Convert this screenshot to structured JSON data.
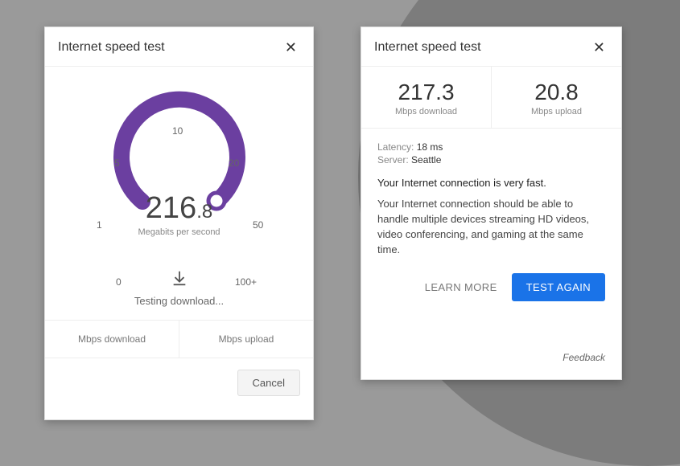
{
  "left": {
    "title": "Internet speed test",
    "ticks": {
      "t0": "0",
      "t1": "1",
      "t5": "5",
      "t10": "10",
      "t20": "20",
      "t50": "50",
      "t100": "100+"
    },
    "speed_int": "216",
    "speed_dec": ".8",
    "unit": "Megabits per second",
    "status": "Testing download...",
    "summary_download_label": "Mbps download",
    "summary_upload_label": "Mbps upload",
    "cancel_label": "Cancel"
  },
  "right": {
    "title": "Internet speed test",
    "download_value": "217.3",
    "download_label": "Mbps download",
    "upload_value": "20.8",
    "upload_label": "Mbps upload",
    "latency_key": "Latency:",
    "latency_val": "18 ms",
    "server_key": "Server:",
    "server_val": "Seattle",
    "headline": "Your Internet connection is very fast.",
    "body": "Your Internet connection should be able to handle multiple devices streaming HD videos, video conferencing, and gaming at the same time.",
    "learn_more": "LEARN MORE",
    "test_again": "TEST AGAIN",
    "feedback": "Feedback"
  },
  "colors": {
    "gauge": "#6b3fa0",
    "accent": "#1a73e8"
  },
  "chart_data": {
    "type": "gauge",
    "value": 216.8,
    "unit": "Mbps",
    "ticks": [
      0,
      1,
      5,
      10,
      20,
      50,
      100
    ],
    "tick_labels": [
      "0",
      "1",
      "5",
      "10",
      "20",
      "50",
      "100+"
    ],
    "fill_fraction": 1.0
  }
}
